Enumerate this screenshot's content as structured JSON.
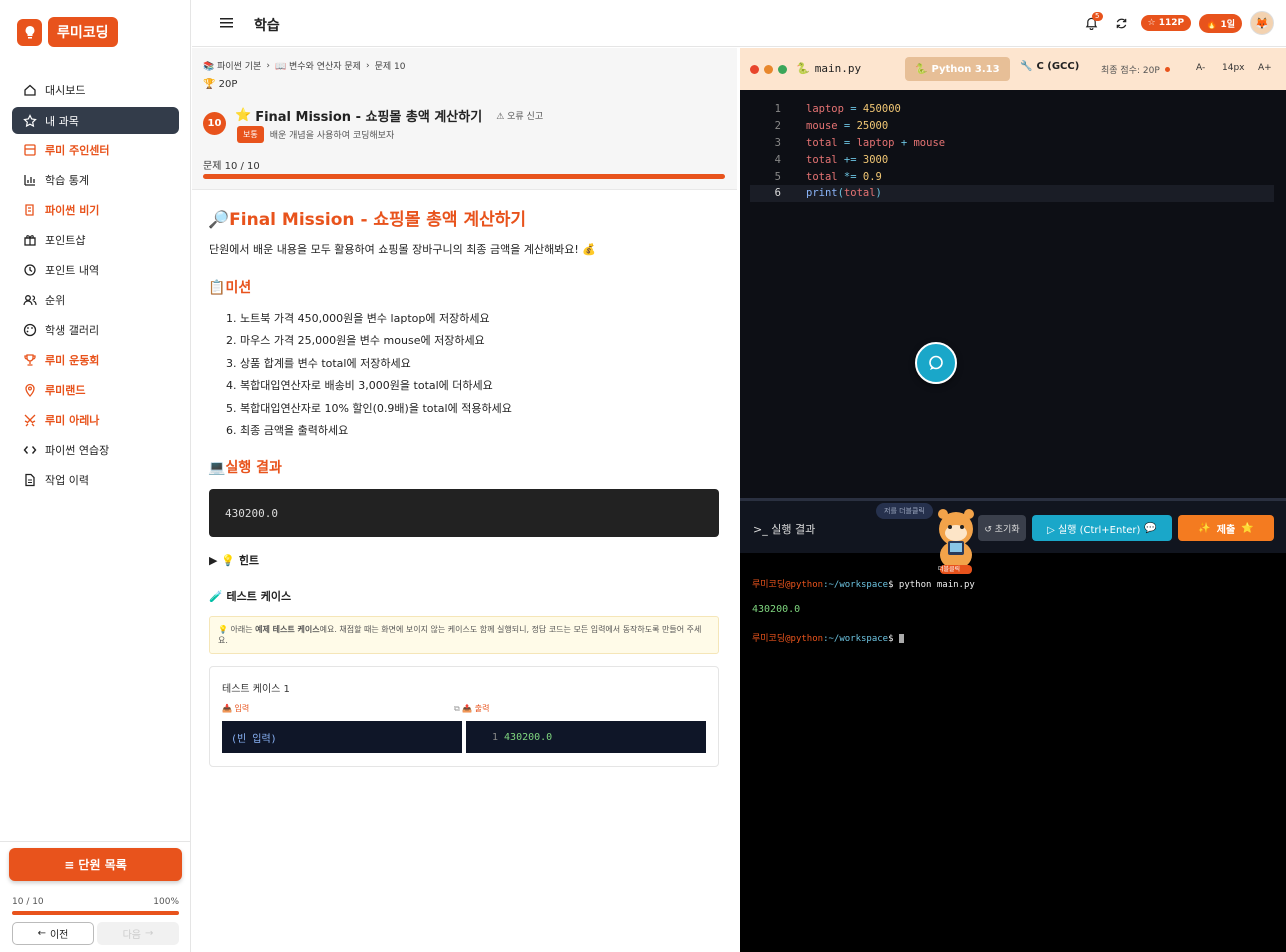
{
  "brand": {
    "name": "루미코딩",
    "accent": "#e8531c"
  },
  "sidebar": {
    "items": [
      {
        "label": "대시보드",
        "icon": "home-icon",
        "active": false,
        "highlight": false
      },
      {
        "label": "내 과목",
        "icon": "star-icon",
        "active": true,
        "highlight": false
      },
      {
        "label": "루미 주인센터",
        "icon": "store-icon",
        "active": false,
        "highlight": true
      },
      {
        "label": "학습 통계",
        "icon": "chart-icon",
        "active": false,
        "highlight": false
      },
      {
        "label": "파이썬 비기",
        "icon": "scroll-icon",
        "active": false,
        "highlight": true
      },
      {
        "label": "포인트샵",
        "icon": "gift-icon",
        "active": false,
        "highlight": false
      },
      {
        "label": "포인트 내역",
        "icon": "history-icon",
        "active": false,
        "highlight": false
      },
      {
        "label": "순위",
        "icon": "users-icon",
        "active": false,
        "highlight": false
      },
      {
        "label": "학생 갤러리",
        "icon": "palette-icon",
        "active": false,
        "highlight": false
      },
      {
        "label": "루미 운동회",
        "icon": "trophy-icon",
        "active": false,
        "highlight": true
      },
      {
        "label": "루미랜드",
        "icon": "pin-icon",
        "active": false,
        "highlight": true
      },
      {
        "label": "루미 아레나",
        "icon": "swords-icon",
        "active": false,
        "highlight": true
      },
      {
        "label": "파이썬 연습장",
        "icon": "code-icon",
        "active": false,
        "highlight": false
      },
      {
        "label": "작업 이력",
        "icon": "file-icon",
        "active": false,
        "highlight": false
      }
    ],
    "unit_list_label": "≡ 단원 목록",
    "progress_text": "10 / 10",
    "progress_percent_text": "100%",
    "progress_value": 1.0,
    "prev_label": "이전",
    "next_label": "다음"
  },
  "topbar": {
    "title": "학습",
    "notification_count": "5",
    "points": "112P",
    "rank": "1일"
  },
  "problem": {
    "breadcrumb": [
      "📚 파이썬 기본",
      "📖 변수와 연산자 문제",
      "문제 10"
    ],
    "points": "20P",
    "number": "10",
    "title": "Final Mission - 쇼핑몰 총액 계산하기",
    "report_label": "⚠ 오류 신고",
    "difficulty": "보통",
    "subtitle": "배운 개념을 사용하여 코딩해보자",
    "count_text": "문제 10 / 10",
    "body_title": "Final Mission - 쇼핑몰 총액 계산하기",
    "description": "단원에서 배운 내용을 모두 활용하여 쇼핑몰 장바구니의 최종 금액을 계산해봐요! 💰",
    "mission_heading": "미션",
    "missions": [
      "1. 노트북 가격 450,000원을 변수 laptop에 저장하세요",
      "2. 마우스 가격 25,000원을 변수 mouse에 저장하세요",
      "3. 상품 합계를 변수 total에 저장하세요",
      "4. 복합대입연산자로 배송비 3,000원을 total에 더하세요",
      "5. 복합대입연산자로 10% 할인(0.9배)을 total에 적용하세요",
      "6. 최종 금액을 출력하세요"
    ],
    "result_heading": "실행 결과",
    "result_value": "430200.0",
    "hint_label": "▶ 💡 힌트",
    "testcase_heading": "🧪 테스트 케이스",
    "testcase_note_pre": "💡 아래는 ",
    "testcase_note_bold": "예제 테스트 케이스",
    "testcase_note_post": "예요. 채점할 때는 화면에 보이지 않는 케이스도 함께 실행되니, 정답 코드는 모든 입력에서 동작하도록 만들어 주세요.",
    "testcase": {
      "title": "테스트 케이스 1",
      "input_label": "📥 입력",
      "output_label": "📤 출력",
      "input": "(빈 입력)",
      "output_line": "1",
      "output": "430200.0"
    }
  },
  "editor": {
    "filename": "main.py",
    "lang_python": "Python 3.13",
    "lang_c": "C (GCC)",
    "score_label": "최종 점수: 20P",
    "font_minus": "A-",
    "font_size": "14px",
    "font_plus": "A+",
    "lines": [
      {
        "n": "1",
        "tokens": [
          [
            "var",
            "laptop"
          ],
          [
            "op",
            " = "
          ],
          [
            "num",
            "450000"
          ]
        ]
      },
      {
        "n": "2",
        "tokens": [
          [
            "var",
            "mouse"
          ],
          [
            "op",
            " = "
          ],
          [
            "num",
            "25000"
          ]
        ]
      },
      {
        "n": "3",
        "tokens": [
          [
            "var",
            "total"
          ],
          [
            "op",
            " = "
          ],
          [
            "var",
            "laptop"
          ],
          [
            "op",
            " + "
          ],
          [
            "var",
            "mouse"
          ]
        ]
      },
      {
        "n": "4",
        "tokens": [
          [
            "var",
            "total"
          ],
          [
            "op",
            " += "
          ],
          [
            "num",
            "3000"
          ]
        ]
      },
      {
        "n": "5",
        "tokens": [
          [
            "var",
            "total"
          ],
          [
            "op",
            " *= "
          ],
          [
            "num",
            "0.9"
          ]
        ]
      },
      {
        "n": "6",
        "tokens": [
          [
            "fn",
            "print"
          ],
          [
            "op",
            "("
          ],
          [
            "var",
            "total"
          ],
          [
            "op",
            ")"
          ]
        ]
      }
    ]
  },
  "terminal": {
    "title": ">_ 실행 결과",
    "reset_label": "↺ 초기화",
    "run_label": "▷ 실행 (Ctrl+Enter)",
    "submit_label": "제출",
    "tooltip": "저를 더블클릭",
    "mascot_label": "더블클릭",
    "prompt_user": "루미코딩@python",
    "prompt_path": ":~/workspace",
    "command": "$ python main.py",
    "output": "430200.0"
  }
}
